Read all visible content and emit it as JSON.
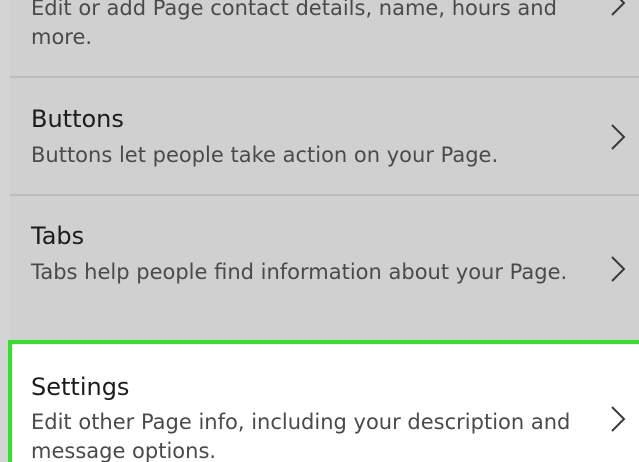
{
  "settings_list": {
    "items": [
      {
        "id": "contact",
        "title": "",
        "description": "Edit or add Page contact details, name, hours and more."
      },
      {
        "id": "buttons",
        "title": "Buttons",
        "description": "Buttons let people take action on your Page."
      },
      {
        "id": "tabs",
        "title": "Tabs",
        "description": "Tabs help people find information about your Page."
      },
      {
        "id": "settings",
        "title": "Settings",
        "description": "Edit other Page info, including your description and message options.",
        "highlighted": true
      }
    ],
    "chevron_icon": "chevron-right-icon",
    "colors": {
      "row_background": "#d0d0d0",
      "highlight_background": "#ffffff",
      "highlight_border": "#33e02a",
      "title_text": "#1c1c1c",
      "description_text": "#4a4a4a"
    }
  }
}
